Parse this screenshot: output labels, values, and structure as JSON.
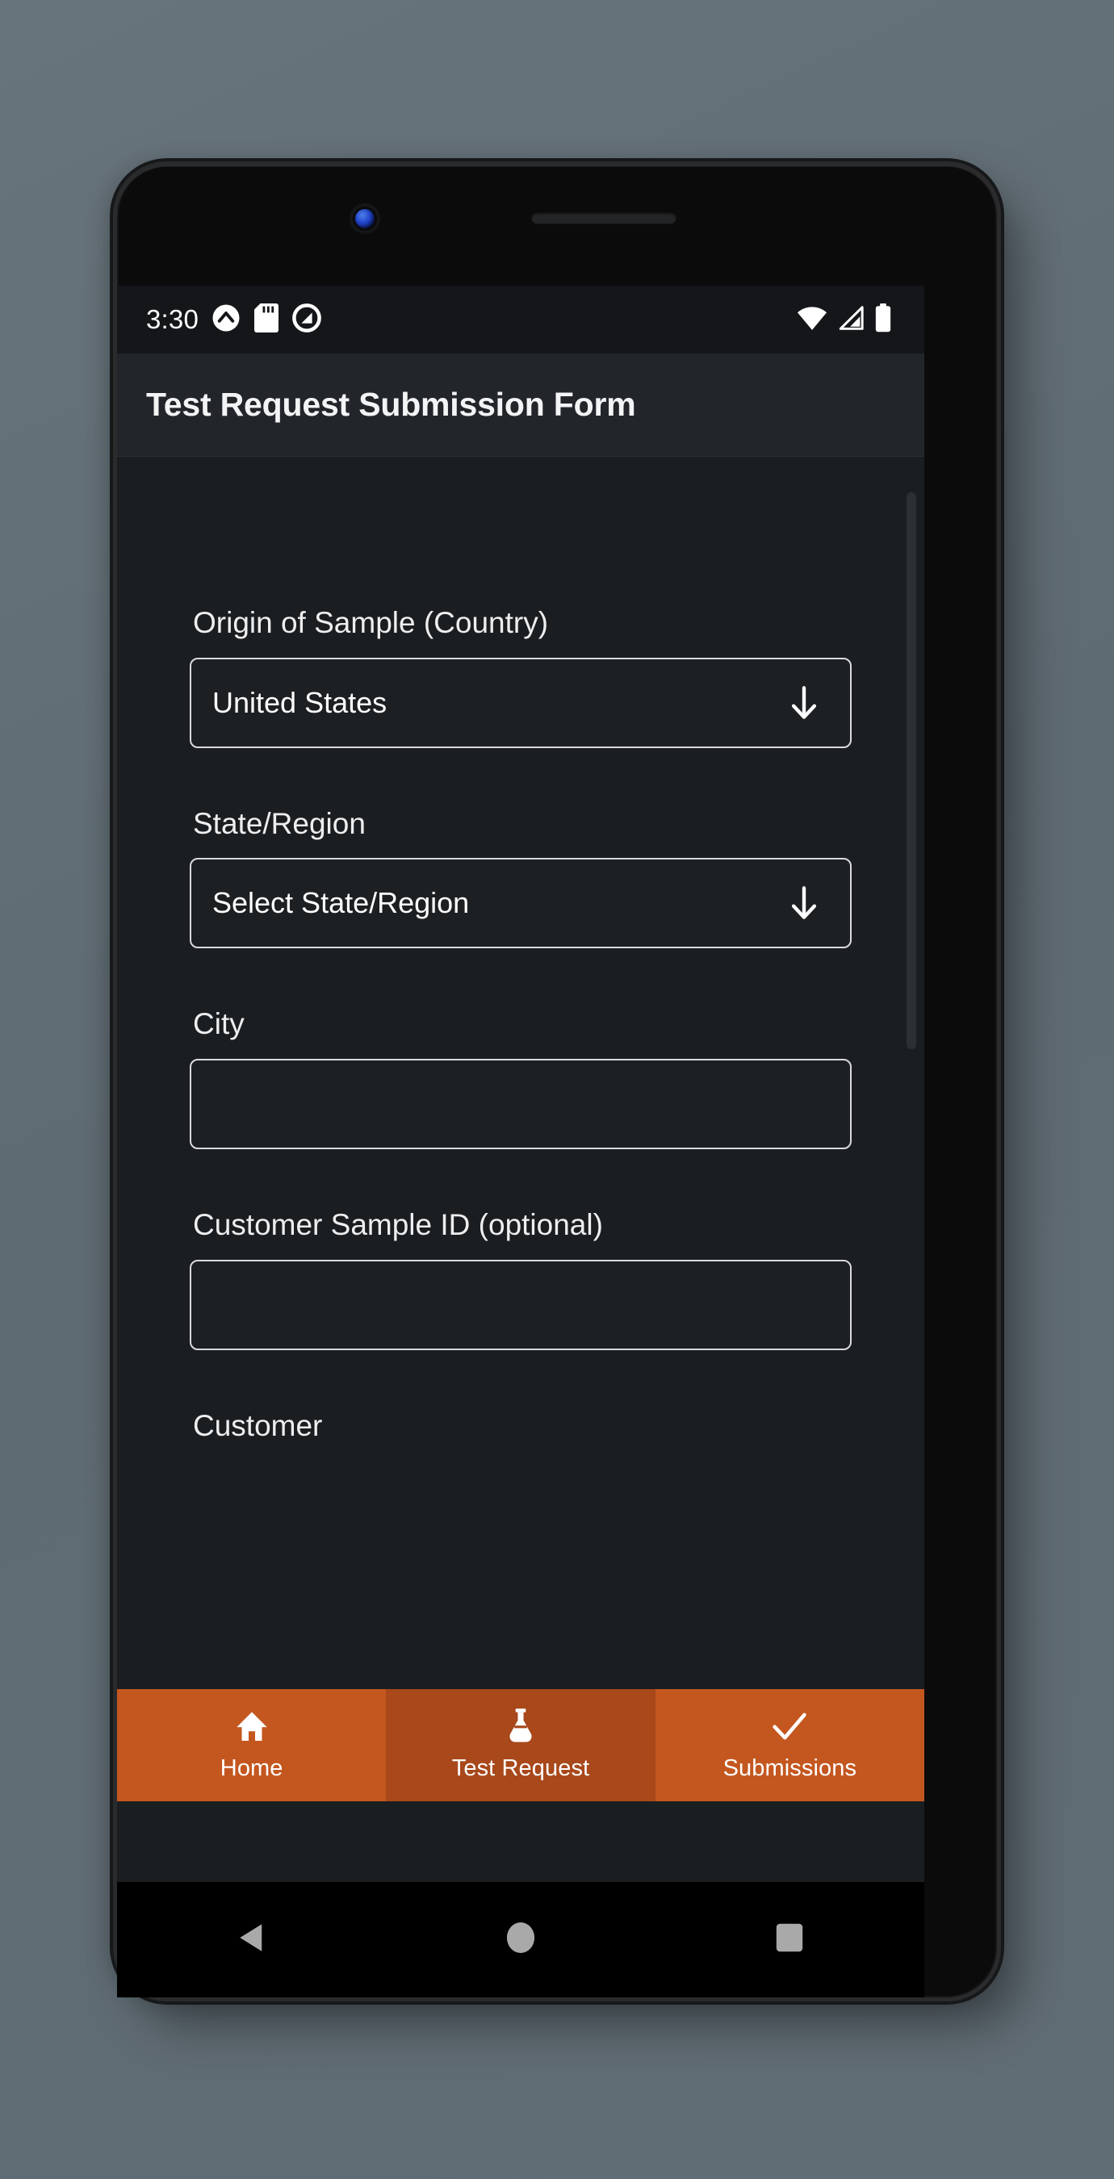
{
  "device": {
    "camera_icon": "front-camera",
    "speaker_icon": "earpiece-speaker"
  },
  "status_bar": {
    "time": "3:30",
    "left_icons": [
      "chevron-up-circle-icon",
      "sd-card-icon",
      "do-not-disturb-icon"
    ],
    "right_icons": [
      "wifi-icon",
      "cellular-signal-icon",
      "battery-full-icon"
    ]
  },
  "app_bar": {
    "title": "Test Request Submission Form"
  },
  "form": {
    "fields": [
      {
        "label": "Origin of Sample (Country)",
        "type": "dropdown",
        "value": "United States",
        "icon": "arrow-down-icon"
      },
      {
        "label": "State/Region",
        "type": "dropdown",
        "value": "Select State/Region",
        "icon": "arrow-down-icon"
      },
      {
        "label": "City",
        "type": "text",
        "value": "",
        "placeholder": ""
      },
      {
        "label": "Customer Sample ID (optional)",
        "type": "text",
        "value": "",
        "placeholder": ""
      },
      {
        "label": "Customer",
        "type": "partial",
        "value": ""
      }
    ]
  },
  "bottom_nav": {
    "items": [
      {
        "label": "Home",
        "icon": "home-icon",
        "active": false
      },
      {
        "label": "Test Request",
        "icon": "flask-icon",
        "active": true
      },
      {
        "label": "Submissions",
        "icon": "check-icon",
        "active": false
      }
    ]
  },
  "android_nav": {
    "back": "back-triangle-icon",
    "home": "home-circle-icon",
    "recents": "recents-square-icon"
  },
  "colors": {
    "accent": "#c4571f",
    "accent_active": "#a8481b",
    "screen_bg": "#1b1e21",
    "appbar_bg": "#22262a",
    "statusbar_bg": "#141619",
    "text": "#ffffff",
    "wallpaper": "#636f77"
  }
}
